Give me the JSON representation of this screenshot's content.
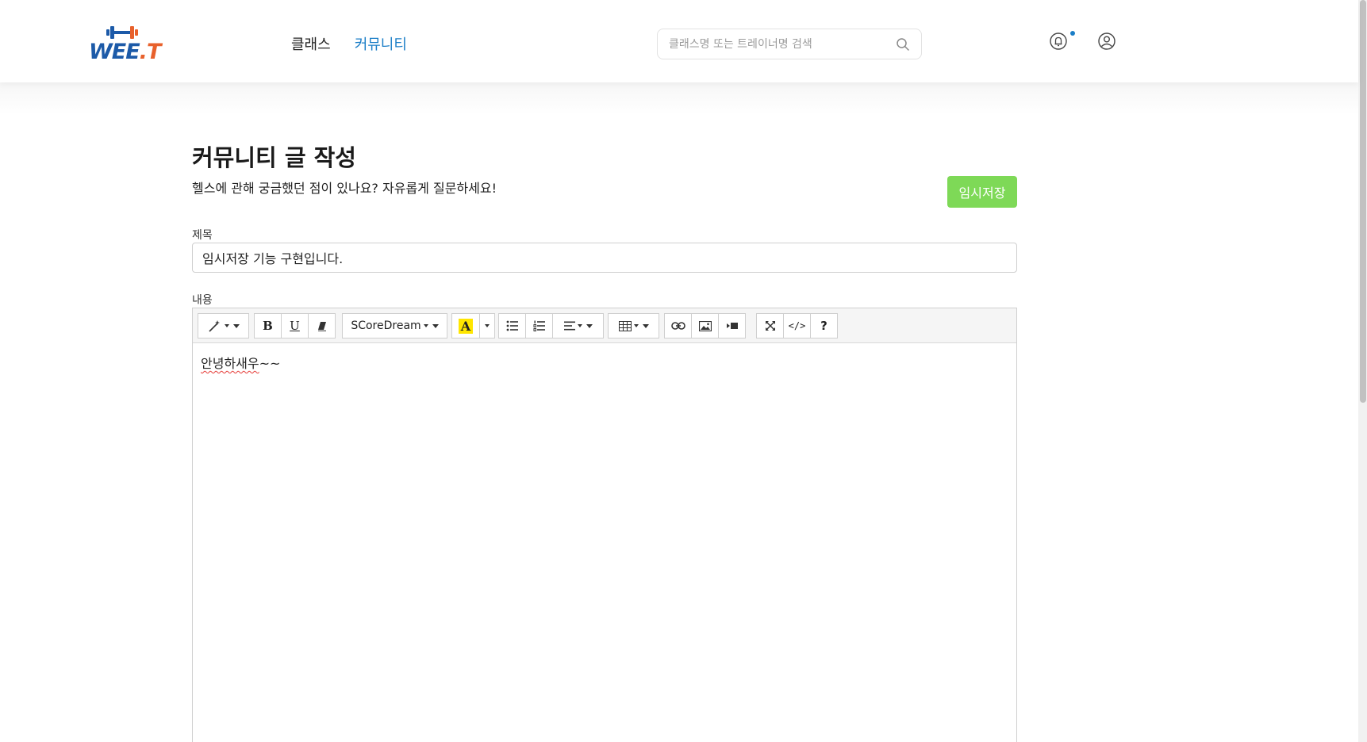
{
  "header": {
    "logo_text_main": "WEE",
    "logo_text_dot": ".",
    "logo_text_end": "T",
    "nav": [
      {
        "label": "클래스",
        "active": false
      },
      {
        "label": "커뮤니티",
        "active": true
      }
    ],
    "search": {
      "placeholder": "클래스명 또는 트레이너명 검색",
      "value": ""
    },
    "icons": {
      "search": "search-icon",
      "notification": "bell-icon",
      "account": "user-circle-icon"
    }
  },
  "page": {
    "title": "커뮤니티 글 작성",
    "subtitle": "헬스에 관해 궁금했던 점이 있나요? 자유롭게 질문하세요!",
    "temp_save_label": "임시저장"
  },
  "form": {
    "title_label": "제목",
    "title_value": "임시저장 기능 구현입니다.",
    "content_label": "내용",
    "content_text_misspelled": "안녕하새우",
    "content_text_rest": "~~"
  },
  "toolbar": {
    "bold_label": "B",
    "underline_label": "U",
    "font_name": "SCoreDream",
    "color_label": "A",
    "help_label": "?",
    "code_label": "</>"
  },
  "colors": {
    "accent": "#1b7ec7",
    "save_button": "#7ed957",
    "logo_blue": "#1c5aa8",
    "logo_orange": "#e8612c",
    "highlight_yellow": "#ffe600"
  }
}
